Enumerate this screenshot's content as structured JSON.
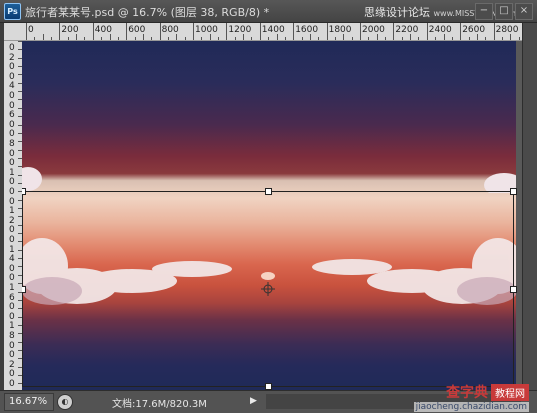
{
  "window": {
    "app_icon_label": "Ps",
    "title": "旅行者某某号.psd @ 16.7% (图层 38, RGB/8) *",
    "watermark": "思缘设计论坛",
    "watermark_url": "www.MISSYUAN.com",
    "buttons": {
      "minimize": "−",
      "maximize": "□",
      "close": "×"
    }
  },
  "ruler_h": {
    "labels": [
      "0",
      "200",
      "400",
      "600",
      "800",
      "1000",
      "1200",
      "1400",
      "1600",
      "1800",
      "2000",
      "2200",
      "2400",
      "2600",
      "2800"
    ]
  },
  "ruler_v": {
    "labels": [
      "0",
      "2",
      "0",
      "0",
      "4",
      "0",
      "0",
      "6",
      "0",
      "0",
      "8",
      "0",
      "0",
      "1",
      "0",
      "0",
      "0",
      "1",
      "2",
      "0",
      "0",
      "1",
      "4",
      "0",
      "0",
      "1",
      "6",
      "0",
      "0",
      "1",
      "8",
      "0",
      "0",
      "2",
      "0",
      "0"
    ]
  },
  "status": {
    "zoom": "16.67%",
    "doc_info": "文档:17.6M/820.3M",
    "menu_arrow": "▶"
  },
  "watermark_bottom": {
    "site": "查字典",
    "badge": "教程网",
    "url": "jiaocheng.chazidian.com"
  },
  "colors": {
    "title_bar": "#4a4a4a",
    "ruler": "#d9d9d9",
    "status_bar": "#535353",
    "sky_top": "#202a58",
    "horizon": "#d9664e"
  }
}
